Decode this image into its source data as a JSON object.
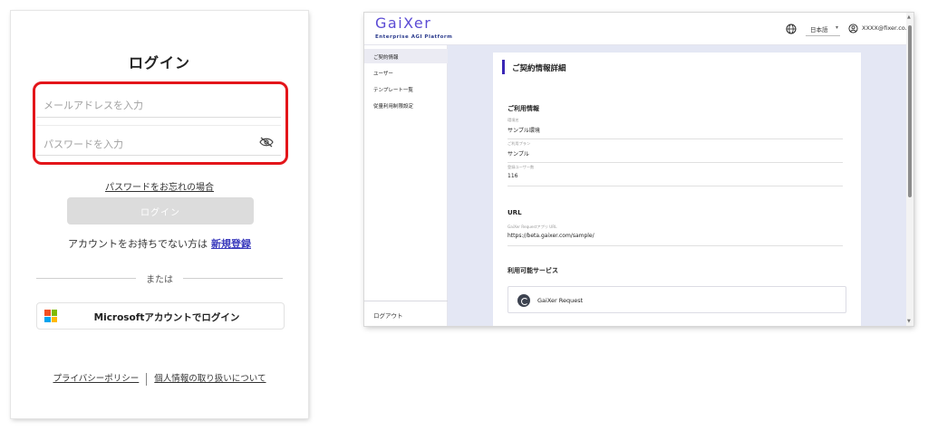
{
  "login": {
    "title": "ログイン",
    "email_placeholder": "メールアドレスを入力",
    "password_placeholder": "パスワードを入力",
    "forgot_password": "パスワードをお忘れの場合",
    "login_button": "ログイン",
    "no_account_text": "アカウントをお持ちでない方は",
    "signup_link": "新規登録",
    "divider_text": "または",
    "microsoft_button": "Microsoftアカウントでログイン",
    "privacy_policy": "プライバシーポリシー",
    "personal_info": "個人情報の取り扱いについて",
    "highlight_color": "#e3151a"
  },
  "app": {
    "logo_name": "GaiXer",
    "logo_tagline": "Enterprise AGI Platform",
    "language": "日本語",
    "user_email": "XXXX@fixer.co.jp",
    "accent_color": "#3a27b5",
    "icons": [
      "globe-icon",
      "user-circle-icon",
      "eye-off-icon",
      "microsoft-logo"
    ],
    "sidebar": {
      "items": [
        {
          "label": "ご契約情報",
          "active": true
        },
        {
          "label": "ユーザー",
          "active": false
        },
        {
          "label": "テンプレート一覧",
          "active": false
        },
        {
          "label": "従量利用制限設定",
          "active": false
        }
      ],
      "logout": "ログアウト"
    },
    "main": {
      "page_title": "ご契約情報詳細",
      "usage_section": "ご利用情報",
      "fields": [
        {
          "label": "環境名",
          "value": "サンプル環境"
        },
        {
          "label": "ご利用プラン",
          "value": "サンプル"
        },
        {
          "label": "登録ユーザー数",
          "value": "116"
        }
      ],
      "url_section": "URL",
      "url_field": {
        "label": "GaiXer Requestアプリ URL",
        "value": "https://beta.gaixer.com/sample/"
      },
      "services_section": "利用可能サービス",
      "service_name": "GaiXer Request"
    }
  }
}
